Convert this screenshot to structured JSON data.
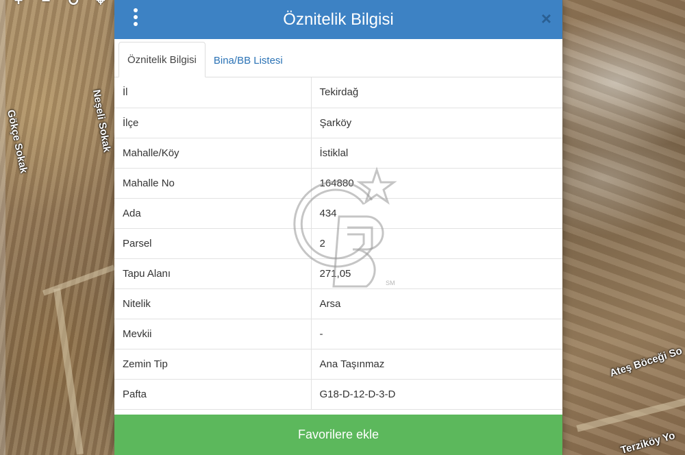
{
  "map": {
    "streets": [
      "Gökçe Sokak",
      "Neşeli Sokak",
      "Ateş Böceği So",
      "Terziköy Yo"
    ],
    "tools": [
      {
        "icon": "plus-icon",
        "glyph": "+"
      },
      {
        "icon": "minus-icon",
        "glyph": "−"
      },
      {
        "icon": "refresh-icon",
        "glyph": "↻"
      },
      {
        "icon": "crosshair-icon",
        "glyph": "⌖"
      }
    ]
  },
  "modal": {
    "title": "Öznitelik Bilgisi",
    "close_glyph": "×",
    "tabs": [
      {
        "label": "Öznitelik Bilgisi",
        "active": true
      },
      {
        "label": "Bina/BB Listesi",
        "active": false
      }
    ],
    "rows": [
      {
        "key": "İl",
        "value": "Tekirdağ"
      },
      {
        "key": "İlçe",
        "value": "Şarköy"
      },
      {
        "key": "Mahalle/Köy",
        "value": "İstiklal"
      },
      {
        "key": "Mahalle No",
        "value": "164880"
      },
      {
        "key": "Ada",
        "value": "434"
      },
      {
        "key": "Parsel",
        "value": "2"
      },
      {
        "key": "Tapu Alanı",
        "value": "271,05"
      },
      {
        "key": "Nitelik",
        "value": "Arsa"
      },
      {
        "key": "Mevkii",
        "value": "-"
      },
      {
        "key": "Zemin Tip",
        "value": "Ana Taşınmaz"
      },
      {
        "key": "Pafta",
        "value": "G18-D-12-D-3-D"
      }
    ],
    "favorite_label": "Favorilere ekle"
  },
  "watermark": {
    "mark": "GB",
    "sub": "SM"
  },
  "colors": {
    "header": "#3d82c4",
    "button": "#5cb85c",
    "tab_link": "#2a72b5"
  }
}
